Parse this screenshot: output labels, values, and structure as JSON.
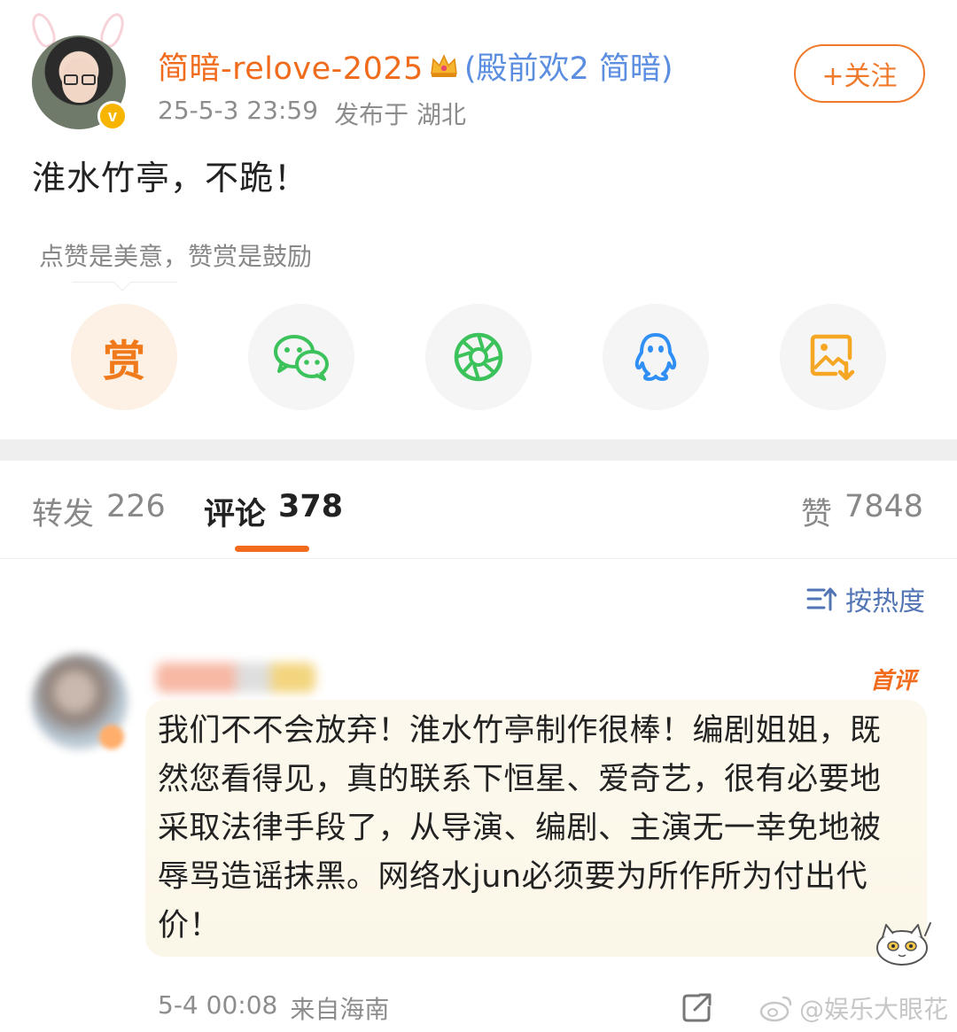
{
  "post": {
    "username": "简暗-relove-2025",
    "fan_title": "(殿前欢2 简暗)",
    "timestamp": "25-5-3 23:59",
    "published_location": "发布于 湖北",
    "follow_label": "+关注",
    "text": "淮水竹亭，不跪！",
    "reward_hint": "点赞是美意，赞赏是鼓励",
    "reward_button": "赏"
  },
  "share_icons": [
    "reward-icon",
    "wechat-icon",
    "moments-icon",
    "qq-icon",
    "save-image-icon"
  ],
  "tabs": {
    "repost_label": "转发",
    "repost_count": "226",
    "comment_label": "评论",
    "comment_count": "378",
    "like_label": "赞",
    "like_count": "7848"
  },
  "sort_label": "按热度",
  "comment": {
    "badge": "首评",
    "text": "我们不不会放弃！淮水竹亭制作很棒！编剧姐姐，既然您看得见，真的联系下恒星、爱奇艺，很有必要地采取法律手段了，从导演、编剧、主演无一幸免地被辱骂造谣抹黑。网络水jun必须要为所作所为付出代价！",
    "time": "5-4 00:08",
    "location": "来自海南"
  },
  "watermark": "@娱乐大眼花",
  "colors": {
    "accent": "#f26b1d",
    "link_blue": "#5b8de0",
    "gray_text": "#8d8d8d"
  }
}
